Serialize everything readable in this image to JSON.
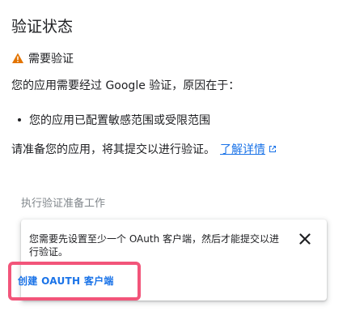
{
  "page": {
    "title": "验证状态"
  },
  "warning": {
    "icon": "warning-icon",
    "label": "需要验证",
    "color": "#e37400"
  },
  "description": "您的应用需要经过 Google 验证，原因在于：",
  "reasons": [
    "您的应用已配置敏感范围或受限范围"
  ],
  "prepare": {
    "text": "请准备您的应用，将其提交以进行验证。",
    "link_label": "了解详情",
    "link_icon": "external-link-icon"
  },
  "step": {
    "label": "执行验证准备工作"
  },
  "card": {
    "message": "您需要先设置至少一个 OAuth 客户端，然后才能提交以进行验证。",
    "close_icon": "close-icon",
    "action_label": "创建 OAUTH 客户端",
    "highlight_color": "#f2557a",
    "link_color": "#1a73e8"
  }
}
